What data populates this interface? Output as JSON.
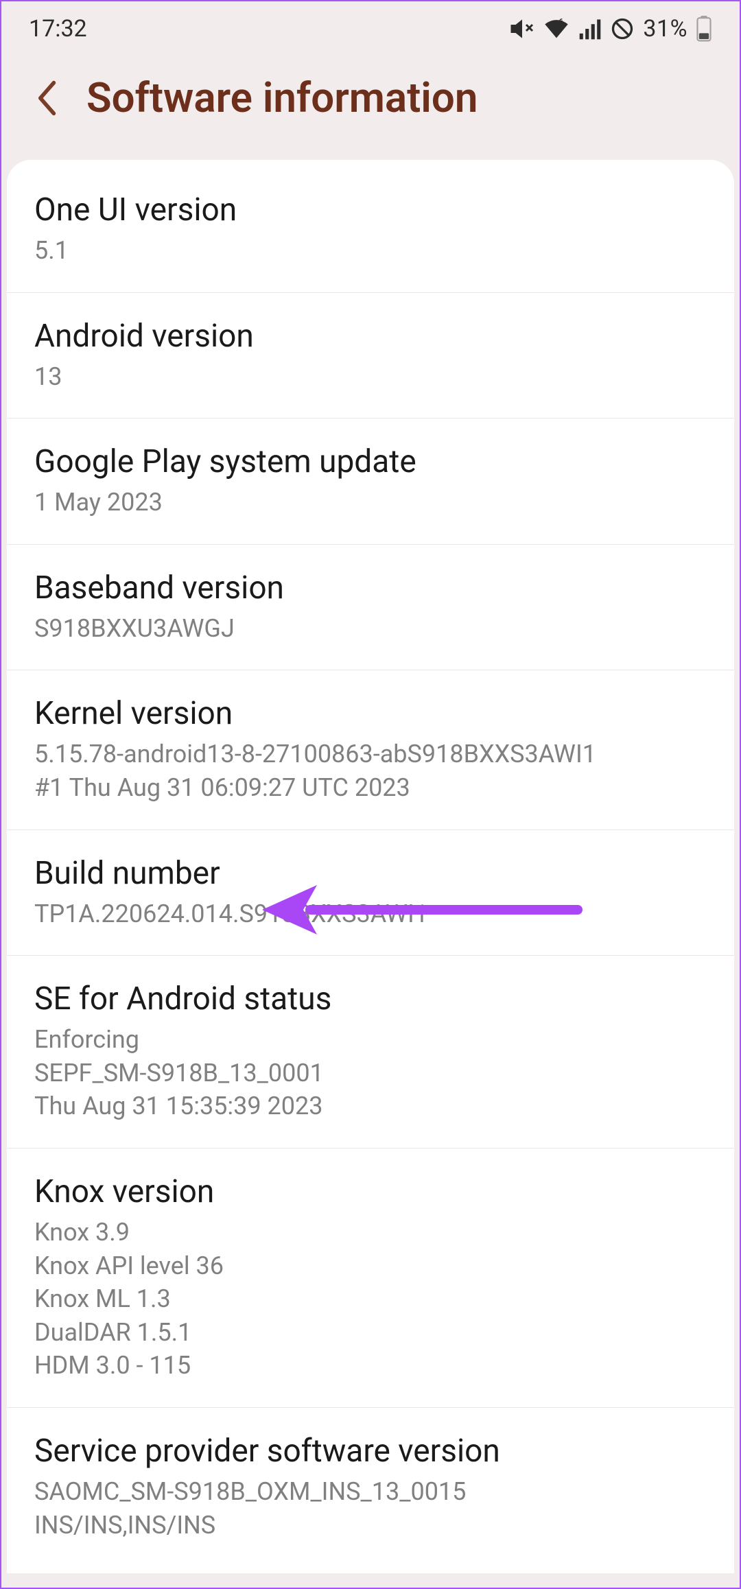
{
  "status_bar": {
    "time": "17:32",
    "battery_pct": "31%"
  },
  "header": {
    "title": "Software information"
  },
  "rows": {
    "one_ui": {
      "label": "One UI version",
      "value": "5.1"
    },
    "android": {
      "label": "Android version",
      "value": "13"
    },
    "play_update": {
      "label": "Google Play system update",
      "value": "1 May 2023"
    },
    "baseband": {
      "label": "Baseband version",
      "value": "S918BXXU3AWGJ"
    },
    "kernel": {
      "label": "Kernel version",
      "value": "5.15.78-android13-8-27100863-abS918BXXS3AWI1\n#1 Thu Aug 31 06:09:27 UTC 2023"
    },
    "build": {
      "label": "Build number",
      "value": "TP1A.220624.014.S918BXXS3AWI1"
    },
    "se_android": {
      "label": "SE for Android status",
      "value": "Enforcing\nSEPF_SM-S918B_13_0001\nThu Aug 31 15:35:39 2023"
    },
    "knox": {
      "label": "Knox version",
      "value": "Knox 3.9\nKnox API level 36\nKnox ML 1.3\nDualDAR 1.5.1\nHDM 3.0 - 115"
    },
    "service_provider": {
      "label": "Service provider software version",
      "value": "SAOMC_SM-S918B_OXM_INS_13_0015\nINS/INS,INS/INS"
    }
  },
  "icons": {
    "mute": "mute-vibrate",
    "wifi": "wifi-6",
    "signal": "cellular",
    "dnd": "do-not-disturb",
    "battery": "battery-31"
  },
  "colors": {
    "accent": "#6b2f1c",
    "bg": "#F2ECEC",
    "card": "#ffffff",
    "annotation": "#a855f7"
  }
}
